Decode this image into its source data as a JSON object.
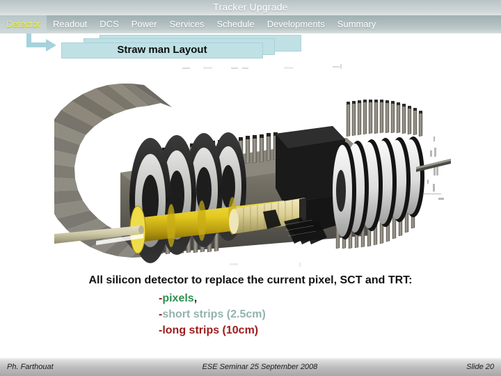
{
  "header": {
    "title": "Tracker Upgrade"
  },
  "nav": {
    "items": [
      {
        "label": "Detector",
        "active": true
      },
      {
        "label": "Readout",
        "active": false
      },
      {
        "label": "DCS",
        "active": false
      },
      {
        "label": "Power",
        "active": false
      },
      {
        "label": "Services",
        "active": false
      },
      {
        "label": "Schedule",
        "active": false
      },
      {
        "label": "Developments",
        "active": false
      },
      {
        "label": "Summary",
        "active": false
      }
    ],
    "active_color": "#f2f23c",
    "text_color": "#ffffff"
  },
  "slide": {
    "title": "Straw man Layout",
    "title_box_color": "#bfe0e4",
    "arrow_color": "#a6d2dc",
    "figure": {
      "alt": "ATLAS all-silicon tracker upgrade cutaway rendering",
      "description": "Three-dimensional cutaway view of the upgraded tracker: concentric barrel cylinders, end-cap disk stacks with radial support fins, yellow inner barrel and beam pipe."
    },
    "body": {
      "headline": "All silicon detector to replace the current pixel, SCT and TRT:",
      "bullets": [
        {
          "dash": "-",
          "text": "pixels",
          "trailing": ",",
          "color": "#2e9150"
        },
        {
          "dash": "-",
          "text": "short strips (2.5cm)",
          "trailing": "",
          "color": "#93b3ad"
        },
        {
          "dash": "-",
          "text": "long strips (10cm)",
          "trailing": "",
          "color": "#9c1b1b"
        }
      ]
    }
  },
  "footer": {
    "author": "Ph. Farthouat",
    "event": "ESE Seminar 25 September 2008",
    "slide_number": "Slide 20"
  }
}
